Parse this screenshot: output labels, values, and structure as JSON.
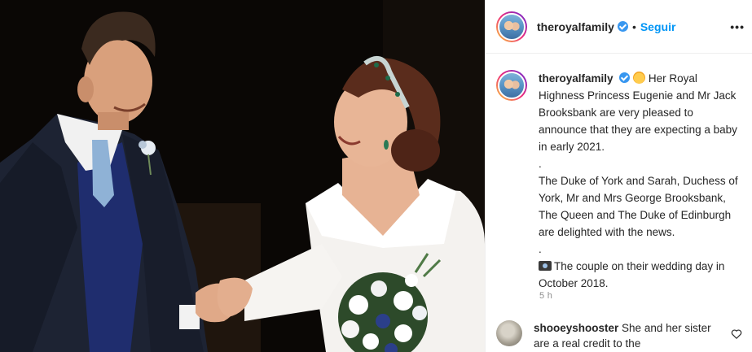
{
  "post": {
    "account": "theroyalfamily",
    "follow_label": "Seguir",
    "more_label": "•••",
    "separator": "•",
    "caption": {
      "line1": "Her Royal Highness Princess Eugenie and Mr Jack Brooksbank are very pleased to announce that they are expecting a baby in early 2021.",
      "dot1": ".",
      "line2": "The Duke of York and Sarah, Duchess of York, Mr and Mrs George Brooksbank, The Queen and The Duke of Edinburgh are delighted with the news.",
      "dot2": ".",
      "line3": "The couple on their wedding day in October 2018."
    },
    "time_ago": "5 h"
  },
  "comment": {
    "username": "shooeyshooster",
    "text": "She and her sister are a real credit to the"
  },
  "icons": {
    "verified": "verified-badge-icon",
    "baby": "baby-emoji-icon",
    "camera": "camera-emoji-icon",
    "heart": "heart-icon",
    "more": "more-options-icon"
  },
  "colors": {
    "link_blue": "#0095f6",
    "verified_blue": "#3897f0",
    "text": "#262626",
    "muted": "#8e8e8e"
  }
}
